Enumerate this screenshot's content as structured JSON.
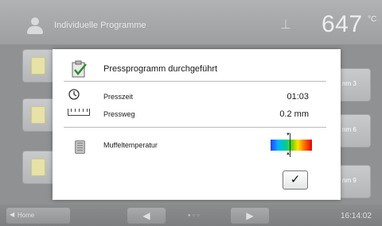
{
  "header": {
    "title": "Individuelle Programme",
    "temperature": "647",
    "temperature_unit": "°C"
  },
  "tiles": [
    {
      "label": ""
    },
    {
      "label": "nm 3"
    },
    {
      "label": ""
    },
    {
      "label": "nm 6"
    },
    {
      "label": ""
    },
    {
      "label": "nm 9"
    }
  ],
  "dialog": {
    "title": "Pressprogramm durchgeführt",
    "press_time_label": "Presszeit",
    "press_time_value": "01:03",
    "press_path_label": "Pressweg",
    "press_path_value": "0.2 mm",
    "muffle_label": "Muffeltemperatur",
    "ok_symbol": "✓"
  },
  "footer": {
    "home_label": "Home",
    "time": "16:14:02",
    "page_dots": "●○○"
  },
  "colors": {
    "gauge_low": "#2a3cff",
    "gauge_high": "#e80000"
  }
}
